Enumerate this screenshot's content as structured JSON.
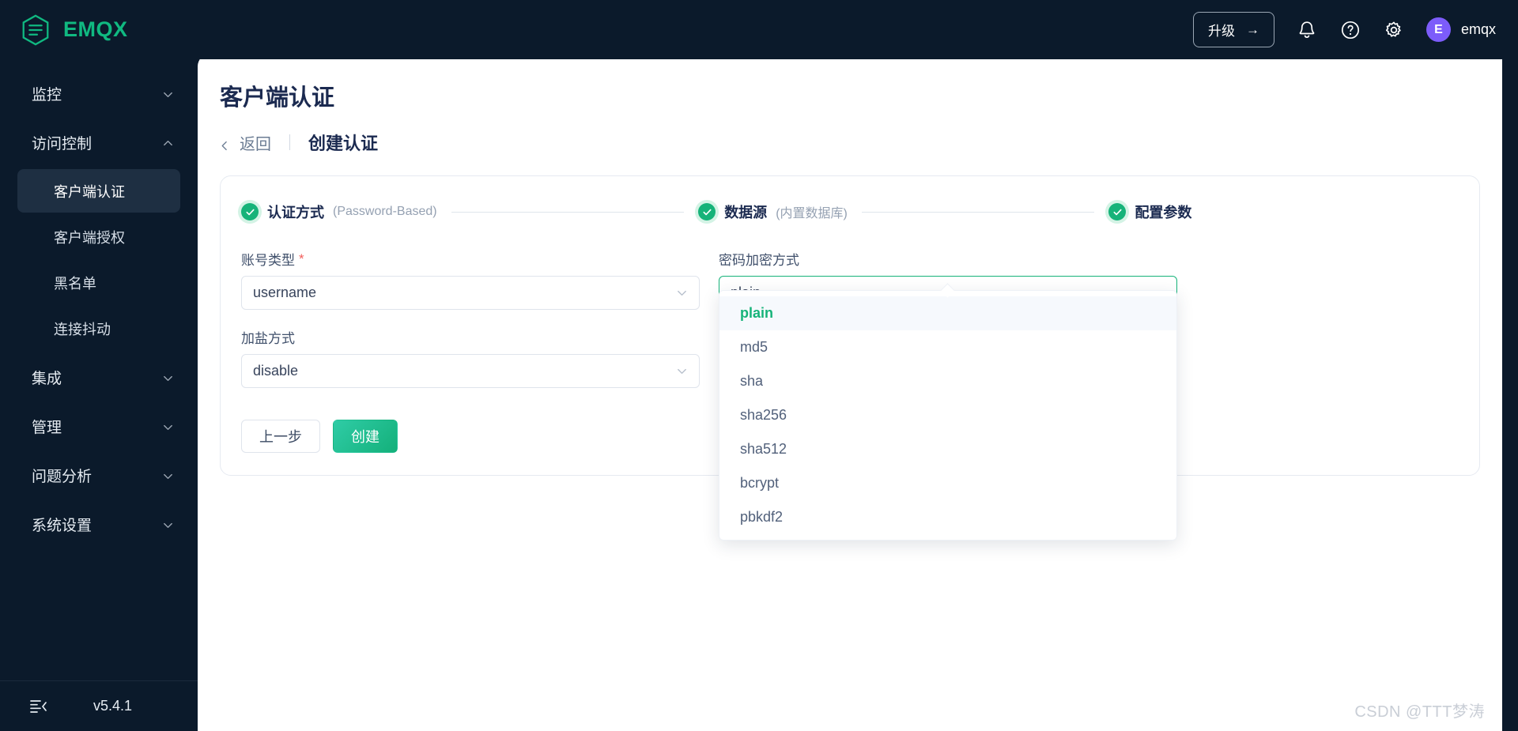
{
  "header": {
    "brand": "EMQX",
    "logo_icon": "emqx-hexagon-logo",
    "upgrade_label": "升级",
    "upgrade_arrow": "→",
    "bell_icon": "bell-icon",
    "help_icon": "question-circle-icon",
    "settings_icon": "gear-icon",
    "avatar_initial": "E",
    "user_name": "emqx"
  },
  "sidebar": {
    "items": [
      {
        "label": "监控",
        "type": "group",
        "expanded": false,
        "chevron": "chevron-down-icon"
      },
      {
        "label": "访问控制",
        "type": "group",
        "expanded": true,
        "chevron": "chevron-up-icon"
      },
      {
        "label": "客户端认证",
        "type": "sub",
        "active": true
      },
      {
        "label": "客户端授权",
        "type": "sub",
        "active": false
      },
      {
        "label": "黑名单",
        "type": "sub",
        "active": false
      },
      {
        "label": "连接抖动",
        "type": "sub",
        "active": false
      },
      {
        "label": "集成",
        "type": "group",
        "expanded": false,
        "chevron": "chevron-down-icon"
      },
      {
        "label": "管理",
        "type": "group",
        "expanded": false,
        "chevron": "chevron-down-icon"
      },
      {
        "label": "问题分析",
        "type": "group",
        "expanded": false,
        "chevron": "chevron-down-icon"
      },
      {
        "label": "系统设置",
        "type": "group",
        "expanded": false,
        "chevron": "chevron-down-icon"
      }
    ],
    "footer": {
      "collapse_icon": "collapse-sidebar-icon",
      "version": "v5.4.1"
    }
  },
  "page": {
    "title": "客户端认证",
    "breadcrumb": {
      "back_icon": "chevron-left-icon",
      "back_label": "返回",
      "current": "创建认证"
    }
  },
  "steps": [
    {
      "title": "认证方式",
      "sub": "(Password-Based)",
      "status": "done",
      "icon": "check-icon"
    },
    {
      "title": "数据源",
      "sub": "(内置数据库)",
      "status": "done",
      "icon": "check-icon"
    },
    {
      "title": "配置参数",
      "sub": "",
      "status": "done",
      "icon": "check-icon"
    }
  ],
  "form": {
    "account_type": {
      "label": "账号类型",
      "required_mark": "*",
      "value": "username",
      "caret_icon": "chevron-down-icon"
    },
    "password_hash": {
      "label": "密码加密方式",
      "value": "plain",
      "caret_icon": "chevron-up-icon",
      "open": true,
      "options": [
        "plain",
        "md5",
        "sha",
        "sha256",
        "sha512",
        "bcrypt",
        "pbkdf2"
      ],
      "selected": "plain"
    },
    "salt_position": {
      "label": "加盐方式",
      "value": "disable",
      "caret_icon": "chevron-down-icon"
    }
  },
  "actions": {
    "prev_label": "上一步",
    "create_label": "创建"
  },
  "watermark": "CSDN @TTT梦涛",
  "colors": {
    "brand_green": "#16b379",
    "sidebar_bg": "#0b1a2b",
    "active_nav_bg": "#1e2f42",
    "title_navy": "#1b2a50",
    "avatar_purple": "#7c5cfa",
    "required_red": "#f25f5c"
  }
}
